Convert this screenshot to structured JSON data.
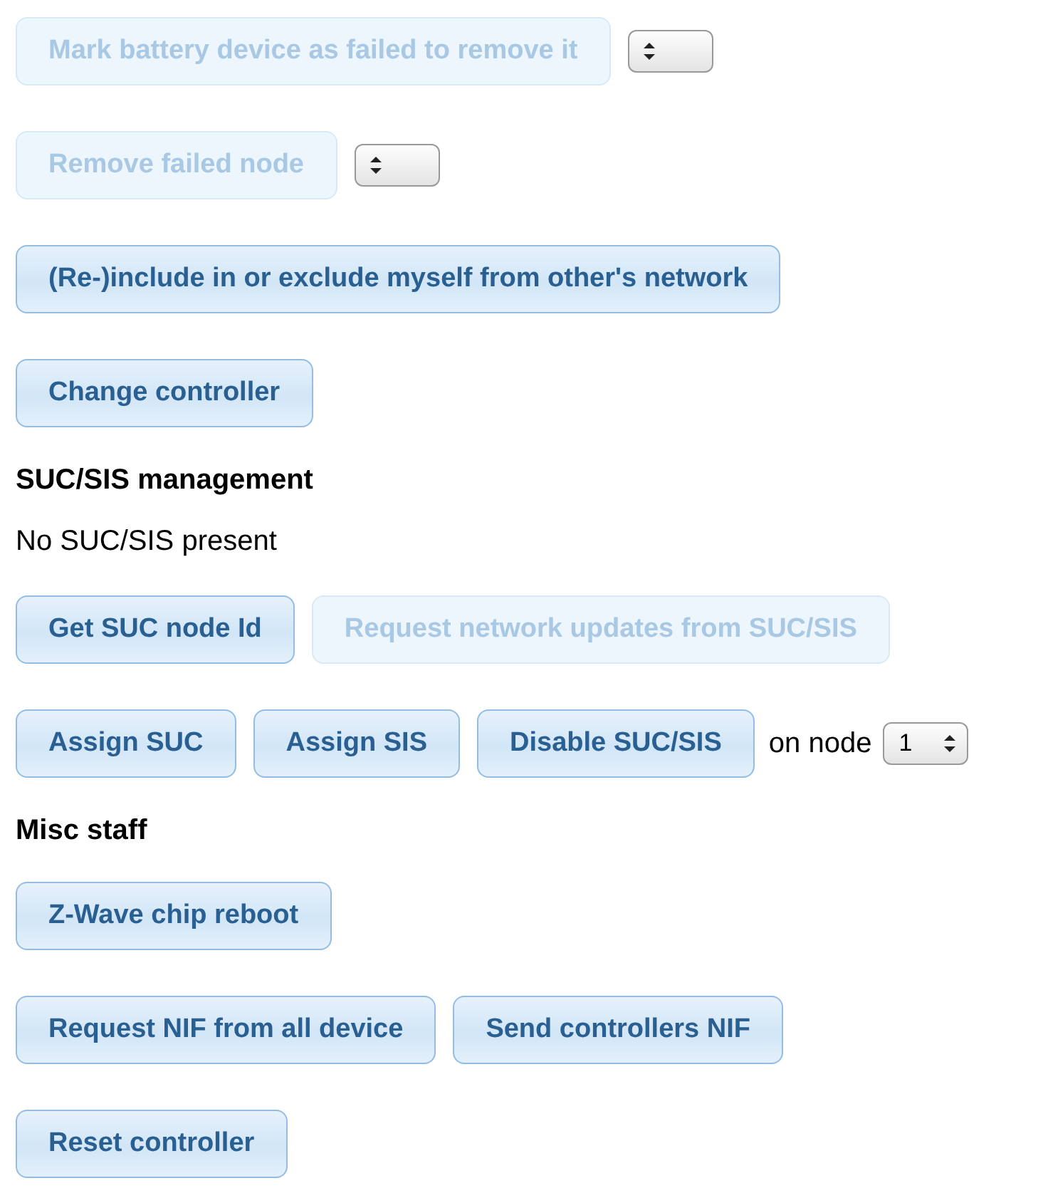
{
  "sections": [
    {
      "rows": [
        [
          {
            "kind": "button",
            "label": "Mark battery device as failed to remove it",
            "disabled": true
          },
          {
            "kind": "select"
          }
        ],
        [
          {
            "kind": "button",
            "label": "Remove failed node",
            "disabled": true
          },
          {
            "kind": "select"
          }
        ],
        [
          {
            "kind": "button",
            "label": "(Re-)include in or exclude myself from other's network",
            "disabled": false
          }
        ],
        [
          {
            "kind": "button",
            "label": "Change controller",
            "disabled": false
          }
        ]
      ]
    },
    {
      "heading": "SUC/SIS management",
      "status": "No SUC/SIS present",
      "rows": [
        [
          {
            "kind": "button",
            "label": "Get SUC node Id",
            "disabled": false
          },
          {
            "kind": "button",
            "label": "Request network updates from SUC/SIS",
            "disabled": true
          }
        ],
        [
          {
            "kind": "button",
            "label": "Assign SUC",
            "disabled": false
          },
          {
            "kind": "button",
            "label": "Assign SIS",
            "disabled": false
          },
          {
            "kind": "button",
            "label": "Disable SUC/SIS",
            "disabled": false
          },
          {
            "kind": "label",
            "label": "on node"
          },
          {
            "kind": "select",
            "value": "1"
          }
        ]
      ]
    },
    {
      "heading": "Misc staff",
      "rows": [
        [
          {
            "kind": "button",
            "label": "Z-Wave chip reboot",
            "disabled": false
          }
        ],
        [
          {
            "kind": "button",
            "label": "Request NIF from all device",
            "disabled": false
          },
          {
            "kind": "button",
            "label": "Send controllers NIF",
            "disabled": false
          }
        ],
        [
          {
            "kind": "button",
            "label": "Reset controller",
            "disabled": false
          }
        ]
      ]
    }
  ]
}
